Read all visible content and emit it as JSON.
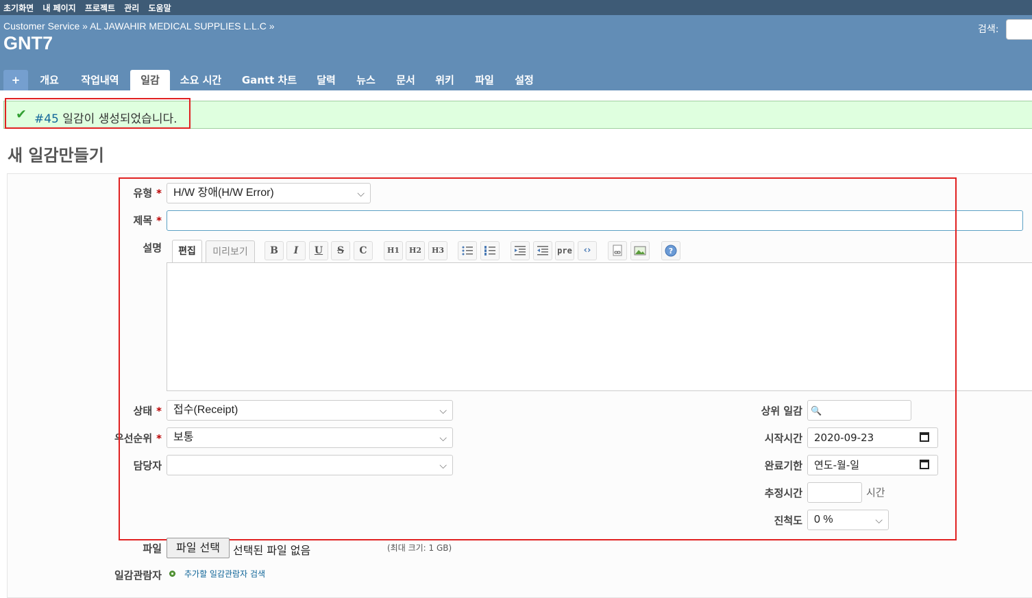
{
  "top_menu": [
    "초기화면",
    "내 페이지",
    "프로젝트",
    "관리",
    "도움말"
  ],
  "breadcrumb": {
    "parent1": "Customer Service",
    "sep": "»",
    "parent2": "AL JAWAHIR MEDICAL SUPPLIES L.L.C"
  },
  "project_title": "GNT7",
  "search": {
    "label": "검색:"
  },
  "tabs": [
    {
      "label": "+"
    },
    {
      "label": "개요"
    },
    {
      "label": "작업내역"
    },
    {
      "label": "일감"
    },
    {
      "label": "소요 시간"
    },
    {
      "label": "Gantt 차트"
    },
    {
      "label": "달력"
    },
    {
      "label": "뉴스"
    },
    {
      "label": "문서"
    },
    {
      "label": "위키"
    },
    {
      "label": "파일"
    },
    {
      "label": "설정"
    }
  ],
  "selected_tab": "일감",
  "flash": {
    "issue_link": "#45",
    "message": " 일감이 생성되었습니다."
  },
  "page_title": "새 일감만들기",
  "form": {
    "tracker_label": "유형",
    "tracker_value": "H/W 장애(H/W Error)",
    "subject_label": "제목",
    "subject_value": "",
    "description_label": "설명",
    "editor_tabs": [
      "편집",
      "미리보기"
    ],
    "toolbar": [
      "B",
      "I",
      "U",
      "S",
      "C",
      "H1",
      "H2",
      "H3",
      "ul",
      "ol",
      "indent",
      "outdent",
      "pre",
      "code",
      "link",
      "image",
      "help"
    ],
    "status_label": "상태",
    "status_value": "접수(Receipt)",
    "priority_label": "우선순위",
    "priority_value": "보통",
    "assignee_label": "담당자",
    "assignee_value": "",
    "parent_label": "상위 일감",
    "start_label": "시작시간",
    "start_value": "2020-09-23",
    "due_label": "완료기한",
    "due_value": "연도-월-일",
    "estimate_label": "추정시간",
    "estimate_unit": "시간",
    "done_label": "진척도",
    "done_value": "0 %",
    "required_mark": "*"
  },
  "files": {
    "label": "파일",
    "button": "파일 선택",
    "none": "선택된 파일 없음",
    "max": "(최대 크기: 1 GB)"
  },
  "watchers": {
    "label": "일감관람자",
    "link": "추가할 일감관람자 검색"
  }
}
